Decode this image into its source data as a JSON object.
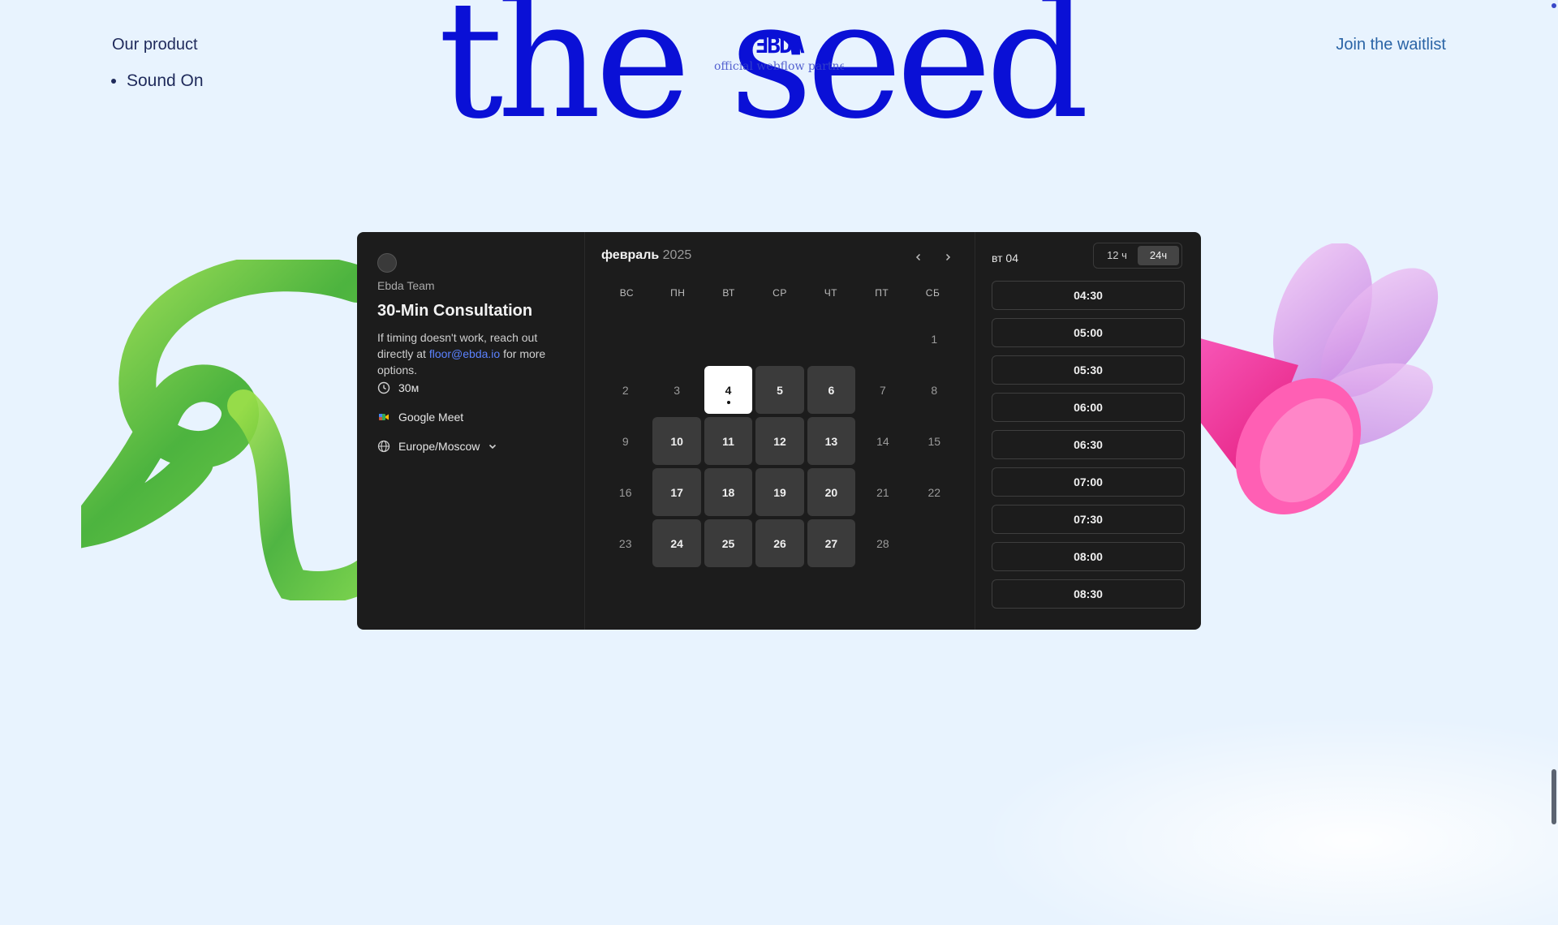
{
  "header": {
    "hero_text": "the seed",
    "nav": {
      "our_product": "Our product",
      "list_items": [
        "Sound On"
      ]
    },
    "logo": {
      "mark": "ƎBDA",
      "subtitle": "official webflow partner"
    },
    "cta": "Join the waitlist"
  },
  "booking": {
    "host": "Ebda Team",
    "event_title": "30-Min Consultation",
    "description_before": "If timing doesn't work, reach out directly at ",
    "email": "floor@ebda.io",
    "description_after": " for more options.",
    "duration": "30м",
    "location": "Google Meet",
    "timezone": "Europe/Moscow",
    "calendar": {
      "month": "февраль",
      "year": "2025",
      "weekdays": [
        "ВС",
        "ПН",
        "ВТ",
        "СР",
        "ЧТ",
        "ПТ",
        "СБ"
      ],
      "leading_blank": 6,
      "days": [
        {
          "d": "1",
          "state": "off"
        },
        {
          "d": "2",
          "state": "off"
        },
        {
          "d": "3",
          "state": "off"
        },
        {
          "d": "4",
          "state": "selected"
        },
        {
          "d": "5",
          "state": "avail"
        },
        {
          "d": "6",
          "state": "avail"
        },
        {
          "d": "7",
          "state": "off"
        },
        {
          "d": "8",
          "state": "off"
        },
        {
          "d": "9",
          "state": "off"
        },
        {
          "d": "10",
          "state": "avail"
        },
        {
          "d": "11",
          "state": "avail"
        },
        {
          "d": "12",
          "state": "avail"
        },
        {
          "d": "13",
          "state": "avail"
        },
        {
          "d": "14",
          "state": "off"
        },
        {
          "d": "15",
          "state": "off"
        },
        {
          "d": "16",
          "state": "off"
        },
        {
          "d": "17",
          "state": "avail"
        },
        {
          "d": "18",
          "state": "avail"
        },
        {
          "d": "19",
          "state": "avail"
        },
        {
          "d": "20",
          "state": "avail"
        },
        {
          "d": "21",
          "state": "off"
        },
        {
          "d": "22",
          "state": "off"
        },
        {
          "d": "23",
          "state": "off"
        },
        {
          "d": "24",
          "state": "avail"
        },
        {
          "d": "25",
          "state": "avail"
        },
        {
          "d": "26",
          "state": "avail"
        },
        {
          "d": "27",
          "state": "avail"
        },
        {
          "d": "28",
          "state": "off"
        }
      ]
    },
    "selected_day_label": "вт 04",
    "format_12h": "12 ч",
    "format_24h": "24ч",
    "time_slots": [
      "04:30",
      "05:00",
      "05:30",
      "06:00",
      "06:30",
      "07:00",
      "07:30",
      "08:00",
      "08:30"
    ]
  },
  "colors": {
    "page_bg": "#e8f3fe",
    "brand_blue": "#0a10d6",
    "widget_bg": "#1c1c1c",
    "available_day": "#3b3b3b"
  }
}
